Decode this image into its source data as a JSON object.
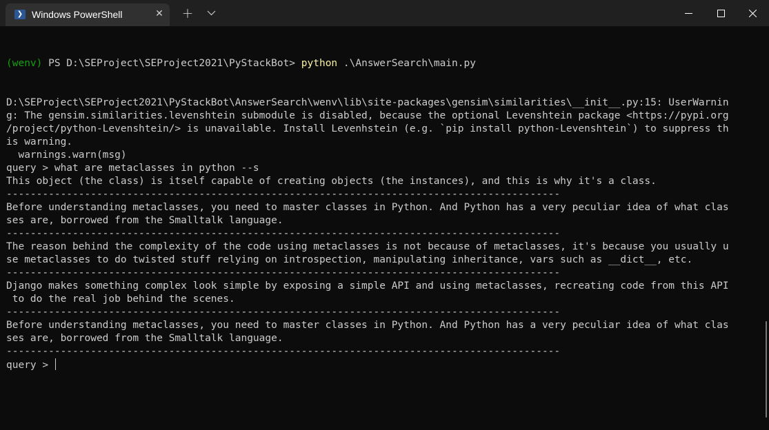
{
  "window": {
    "tab_title": "Windows PowerShell",
    "tab_icon": "powershell-icon",
    "tab_icon_glyph": "❯",
    "close_tab_glyph": "✕",
    "new_tab_glyph": "+",
    "colors": {
      "titlebar": "#202020",
      "tab": "#303030",
      "terminal_bg": "#0c0c0c",
      "terminal_text": "#cccccc",
      "prompt_env": "#13a10e",
      "command": "#f9f1a5"
    }
  },
  "terminal": {
    "prompt": {
      "env": "(wenv)",
      "path": " PS D:\\SEProject\\SEProject2021\\PyStackBot> ",
      "command": "python",
      "args": " .\\AnswerSearch\\main.py"
    },
    "output_lines": [
      "D:\\SEProject\\SEProject2021\\PyStackBot\\AnswerSearch\\wenv\\lib\\site-packages\\gensim\\similarities\\__init__.py:15: UserWarnin",
      "g: The gensim.similarities.levenshtein submodule is disabled, because the optional Levenshtein package <https://pypi.org",
      "/project/python-Levenshtein/> is unavailable. Install Levenhstein (e.g. `pip install python-Levenshtein`) to suppress th",
      "is warning.",
      "  warnings.warn(msg)",
      "query > what are metaclasses in python --s",
      "This object (the class) is itself capable of creating objects (the instances), and this is why it's a class.",
      "--------------------------------------------------------------------------------------------",
      "Before understanding metaclasses, you need to master classes in Python. And Python has a very peculiar idea of what clas",
      "ses are, borrowed from the Smalltalk language.",
      "--------------------------------------------------------------------------------------------",
      "The reason behind the complexity of the code using metaclasses is not because of metaclasses, it's because you usually u",
      "se metaclasses to do twisted stuff relying on introspection, manipulating inheritance, vars such as __dict__, etc.",
      "--------------------------------------------------------------------------------------------",
      "Django makes something complex look simple by exposing a simple API and using metaclasses, recreating code from this API",
      " to do the real job behind the scenes.",
      "--------------------------------------------------------------------------------------------",
      "Before understanding metaclasses, you need to master classes in Python. And Python has a very peculiar idea of what clas",
      "ses are, borrowed from the Smalltalk language.",
      "--------------------------------------------------------------------------------------------"
    ],
    "current_prompt": "query > "
  }
}
